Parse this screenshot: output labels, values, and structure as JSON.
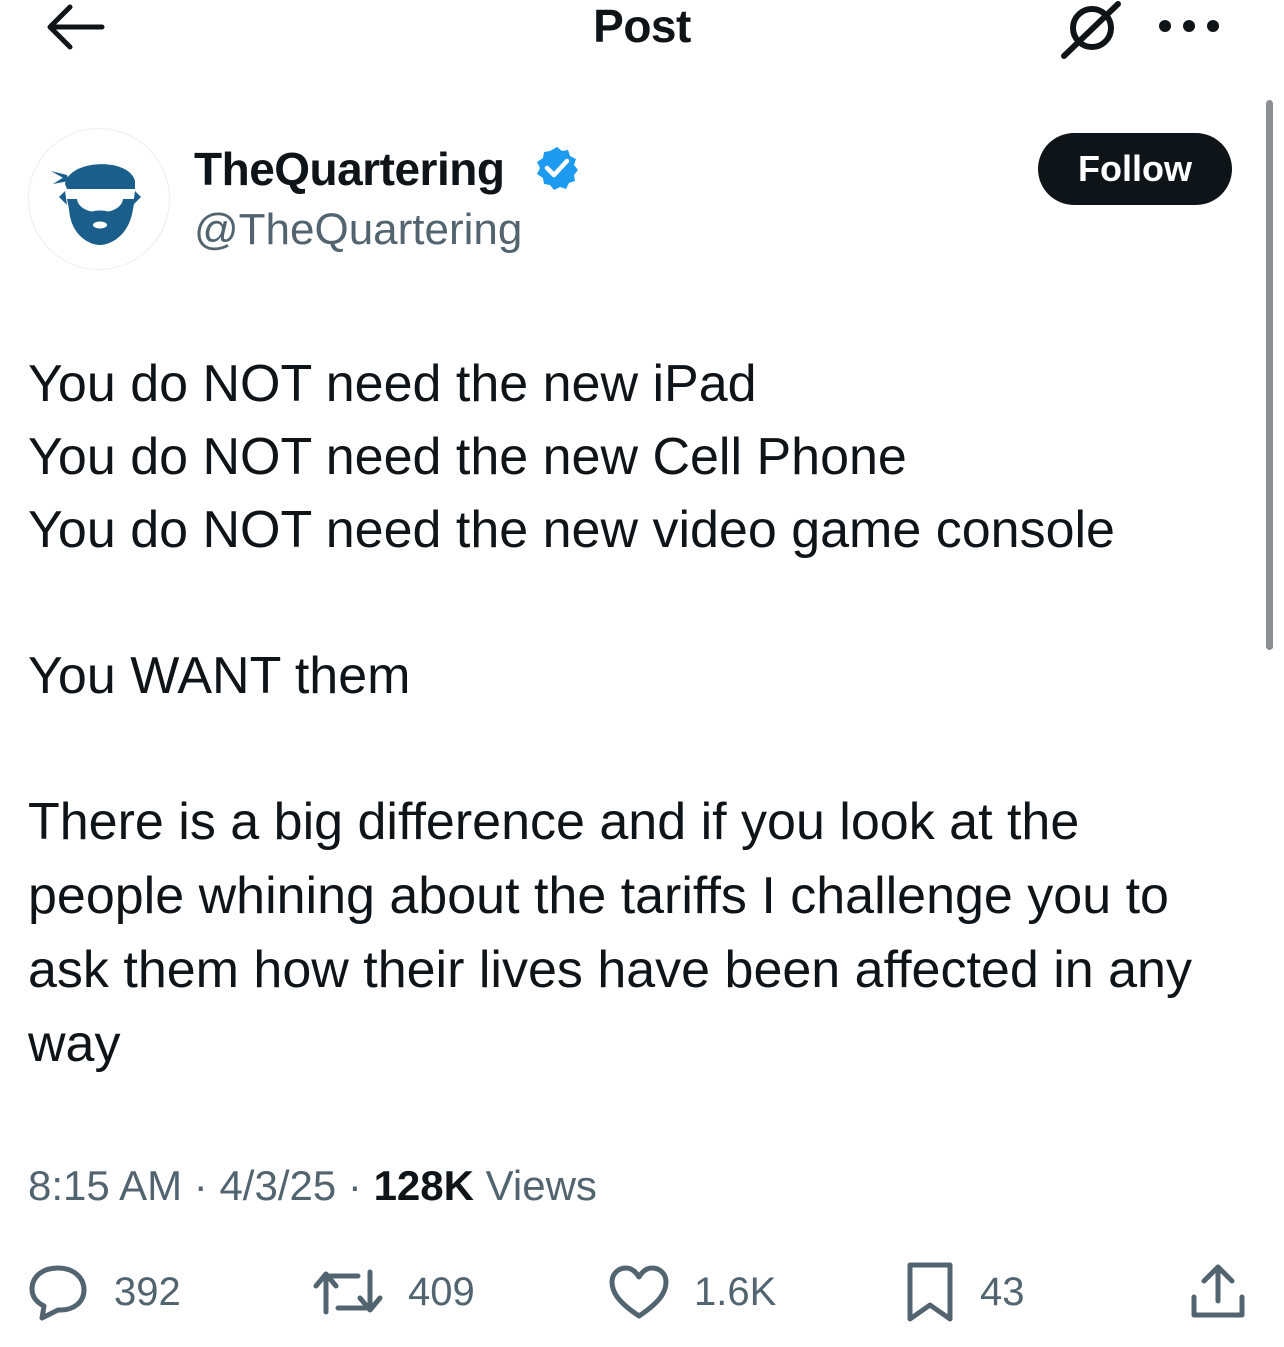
{
  "header": {
    "title": "Post",
    "back_icon": "arrow-left-icon",
    "grok_icon": "grok-icon",
    "more_icon": "more-horizontal-icon"
  },
  "author": {
    "display_name": "TheQuartering",
    "handle": "@TheQuartering",
    "verified": true,
    "verified_color": "#1d9bf0",
    "avatar_color": "#1a5f8c",
    "follow_label": "Follow"
  },
  "tweet": {
    "lines": [
      "You do NOT need the new iPad",
      "You do NOT need the new Cell Phone",
      "You do NOT need the new video game console",
      "",
      "You WANT them",
      "",
      "There is a big difference and if you look at the",
      "people whining about the tariffs I challenge you to",
      "ask them how their lives have been affected in any",
      "way"
    ]
  },
  "meta": {
    "time": "8:15 AM",
    "separator": "·",
    "date": "4/3/25",
    "views_count": "128K",
    "views_label": "Views"
  },
  "actions": {
    "replies": "392",
    "reposts": "409",
    "likes": "1.6K",
    "bookmarks": "43"
  }
}
